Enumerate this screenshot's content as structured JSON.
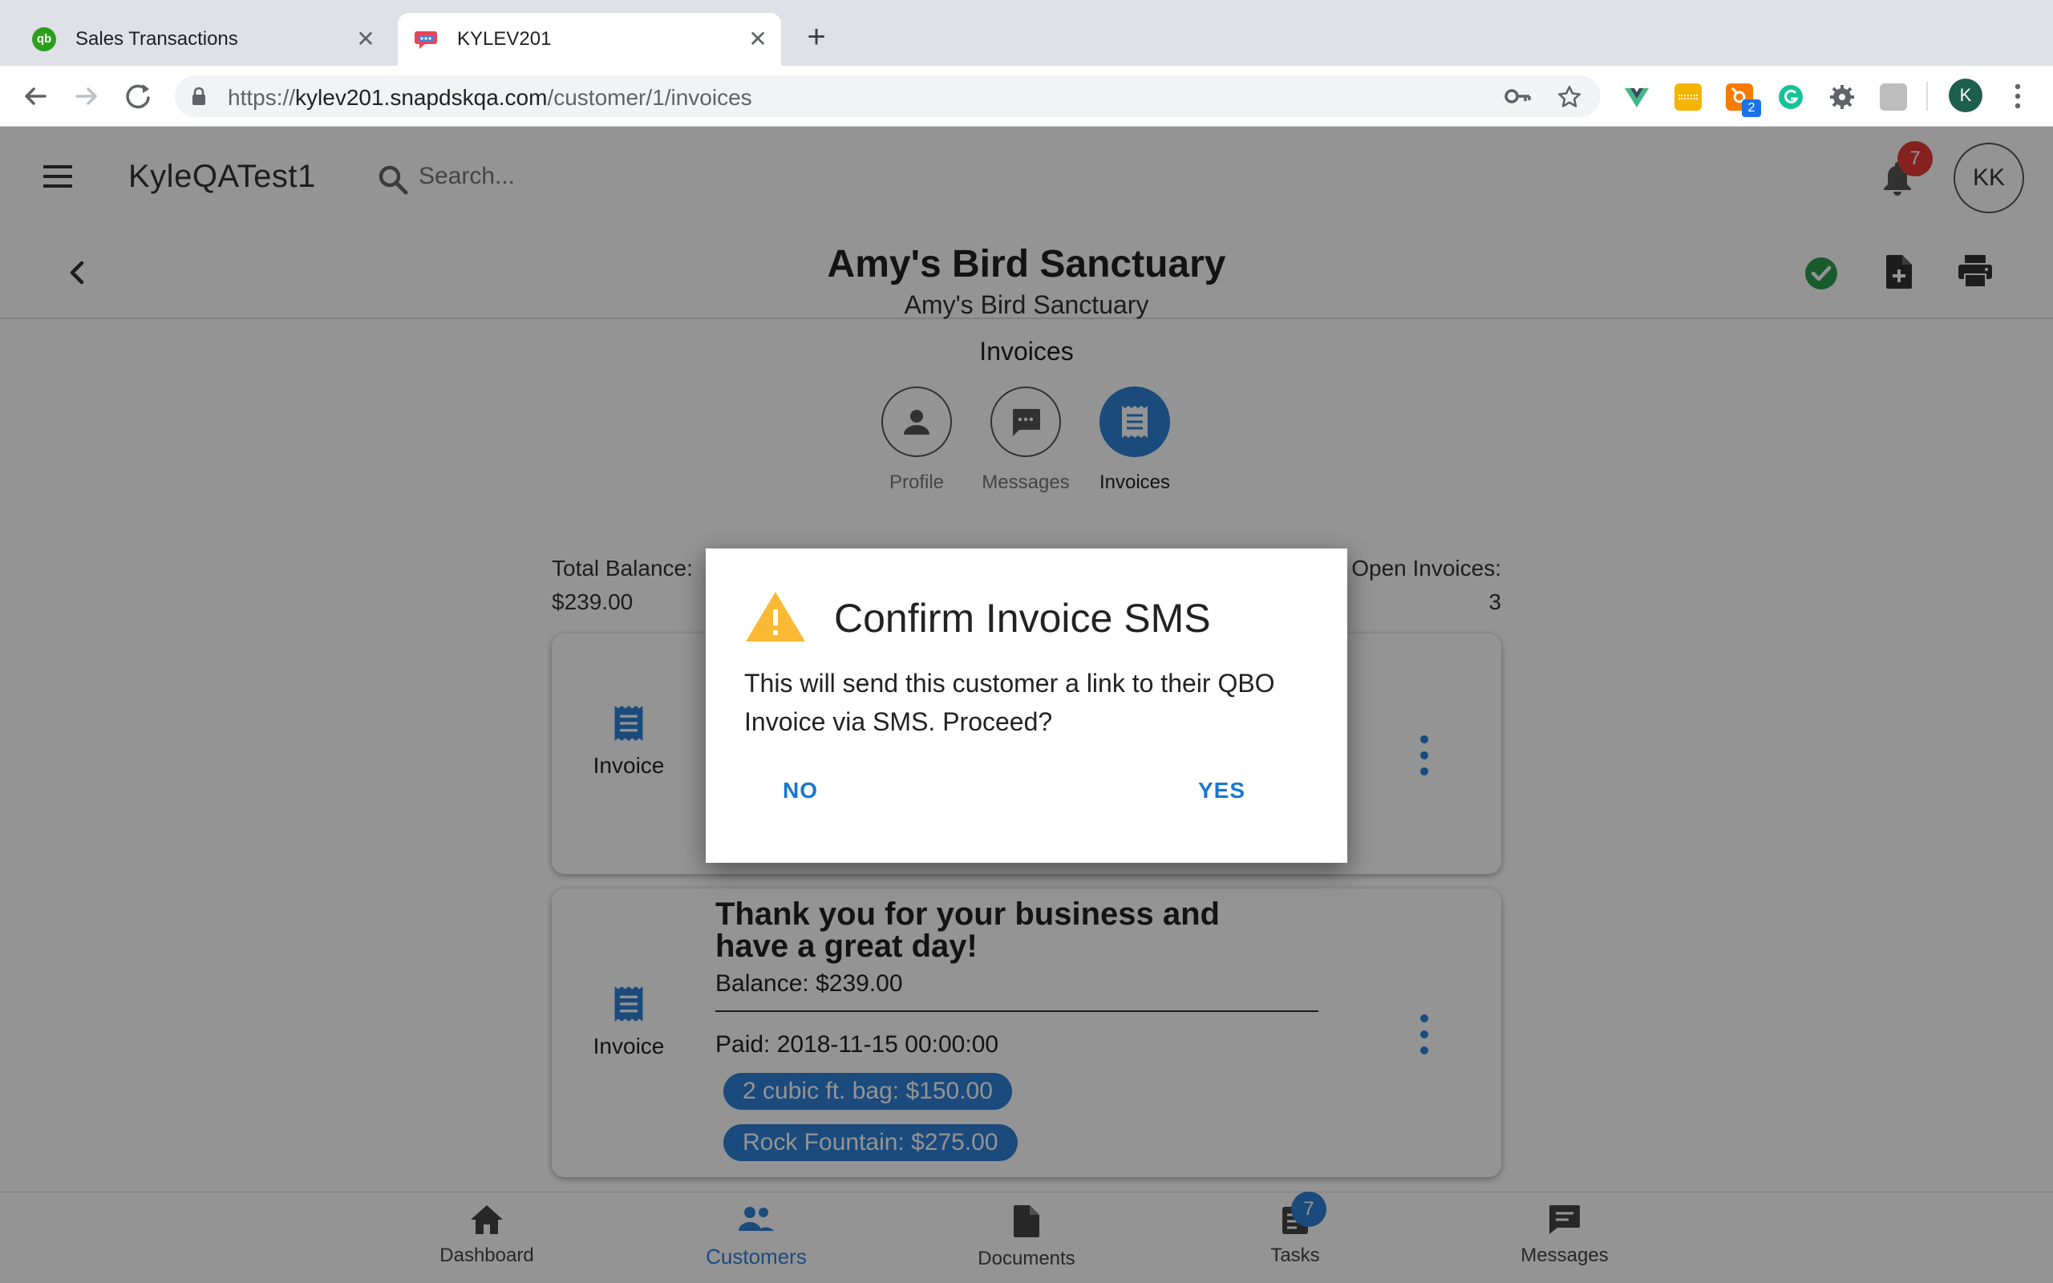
{
  "browser": {
    "tabs": [
      {
        "title": "Sales Transactions",
        "favicon": "qb-icon",
        "active": false
      },
      {
        "title": "KYLEV201",
        "favicon": "chat-bubble-icon",
        "active": true
      }
    ],
    "url": {
      "scheme": "https://",
      "host": "kylev201.snapdskqa.com",
      "path": "/customer/1/invoices"
    },
    "extension_badge": "2",
    "profile_initial": "K"
  },
  "app": {
    "brand": "KyleQATest1",
    "search_placeholder": "Search...",
    "notification_count": "7",
    "avatar_initials": "KK"
  },
  "customer": {
    "title": "Amy's Bird Sanctuary",
    "subtitle": "Amy's Bird Sanctuary"
  },
  "section": {
    "label": "Invoices",
    "nav": [
      {
        "label": "Profile",
        "icon": "person-icon"
      },
      {
        "label": "Messages",
        "icon": "chat-icon"
      },
      {
        "label": "Invoices",
        "icon": "receipt-icon",
        "active": true
      }
    ]
  },
  "summary": {
    "total_balance_label": "Total Balance:",
    "total_balance_value": "$239.00",
    "open_invoices_label": "Open Invoices:",
    "open_invoices_value": "3"
  },
  "cards": [
    {
      "type_label": "Invoice"
    },
    {
      "type_label": "Invoice",
      "heading": "Thank you for your business and have a great day!",
      "balance": "Balance: $239.00",
      "paid": "Paid: 2018-11-15 00:00:00",
      "chips": [
        "2 cubic ft. bag: $150.00",
        "Rock Fountain: $275.00"
      ]
    }
  ],
  "bottom_nav": [
    {
      "label": "Dashboard",
      "icon": "home-icon"
    },
    {
      "label": "Customers",
      "icon": "people-icon",
      "active": true
    },
    {
      "label": "Documents",
      "icon": "document-icon"
    },
    {
      "label": "Tasks",
      "icon": "tasks-icon",
      "badge": "7"
    },
    {
      "label": "Messages",
      "icon": "message-icon"
    }
  ],
  "dialog": {
    "title": "Confirm Invoice SMS",
    "body": "This will send this customer a link to their QBO Invoice via SMS. Proceed?",
    "no_label": "NO",
    "yes_label": "YES",
    "icon": "warning-icon"
  },
  "colors": {
    "accent": "#2f80d6",
    "dialog_button": "#1976d2",
    "badge_red": "#e53935",
    "warning": "#f9b934",
    "check_green": "#2e9e4f"
  }
}
